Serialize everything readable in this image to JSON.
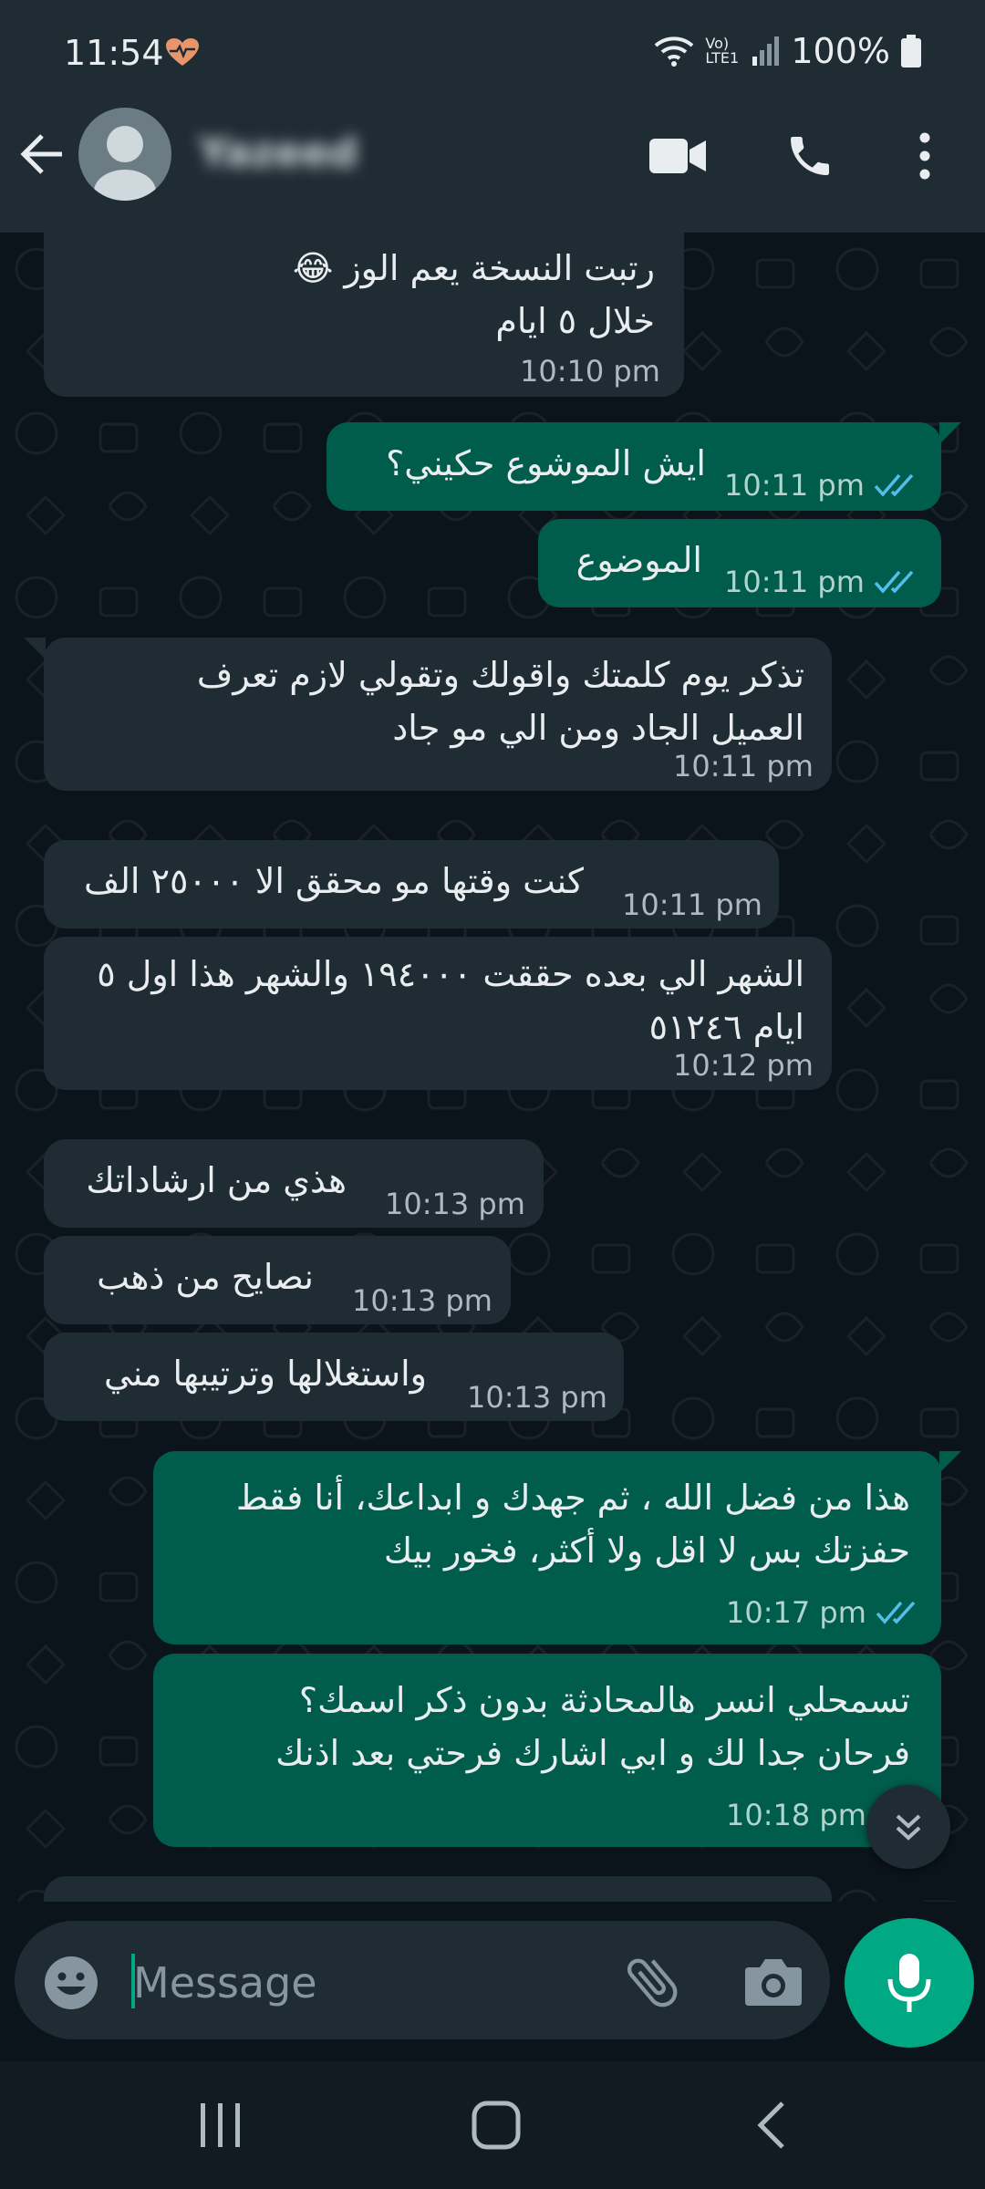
{
  "status_bar": {
    "time": "11:54",
    "network_label": "Vo) LTE1",
    "battery": "100%"
  },
  "header": {
    "contact_name": "Yazeed"
  },
  "messages": [
    {
      "dir": "in",
      "text": "رتبت النسخة يعم الوز 😂\nخلال ٥ ايام",
      "time": "10:10 pm"
    },
    {
      "dir": "out",
      "text": "ايش الموشوع حكيني؟",
      "time": "10:11 pm"
    },
    {
      "dir": "out",
      "text": "الموضوع",
      "time": "10:11 pm"
    },
    {
      "dir": "in",
      "text": "تذكر يوم كلمتك واقولك وتقولي لازم تعرف\nالعميل الجاد ومن الي مو جاد",
      "time": "10:11 pm"
    },
    {
      "dir": "in",
      "text": "كنت وقتها مو محقق الا ٢٥٠٠٠ الف",
      "time": "10:11 pm"
    },
    {
      "dir": "in",
      "text": "الشهر الي بعده حققت ١٩٤٠٠٠ والشهر هذا اول ٥\nايام ٥١٢٤٦",
      "time": "10:12 pm"
    },
    {
      "dir": "in",
      "text": "هذي من ارشاداتك",
      "time": "10:13 pm"
    },
    {
      "dir": "in",
      "text": "نصايح من ذهب",
      "time": "10:13 pm"
    },
    {
      "dir": "in",
      "text": "واستغلالها وترتيبها مني",
      "time": "10:13 pm"
    },
    {
      "dir": "out",
      "text": "هذا من فضل الله ، ثم جهدك و ابداعك، أنا فقط\nحفزتك بس لا اقل ولا أكثر، فخور بيك",
      "time": "10:17 pm"
    },
    {
      "dir": "out",
      "text": "تسمحلي انسر هالمحادثة بدون ذكر اسمك؟\nفرحان جدا لك و ابي اشارك فرحتي بعد اذنك",
      "time": "10:18 pm"
    }
  ],
  "composer": {
    "placeholder": "Message"
  },
  "icons": [
    "back-arrow-icon",
    "video-call-icon",
    "voice-call-icon",
    "more-options-icon",
    "emoji-icon",
    "attach-icon",
    "camera-icon",
    "mic-icon",
    "scroll-down-icon"
  ],
  "colors": {
    "incoming_bubble": "#202c33",
    "outgoing_bubble": "#005c4b",
    "accent": "#00a884",
    "tick_read": "#53bdeb"
  }
}
